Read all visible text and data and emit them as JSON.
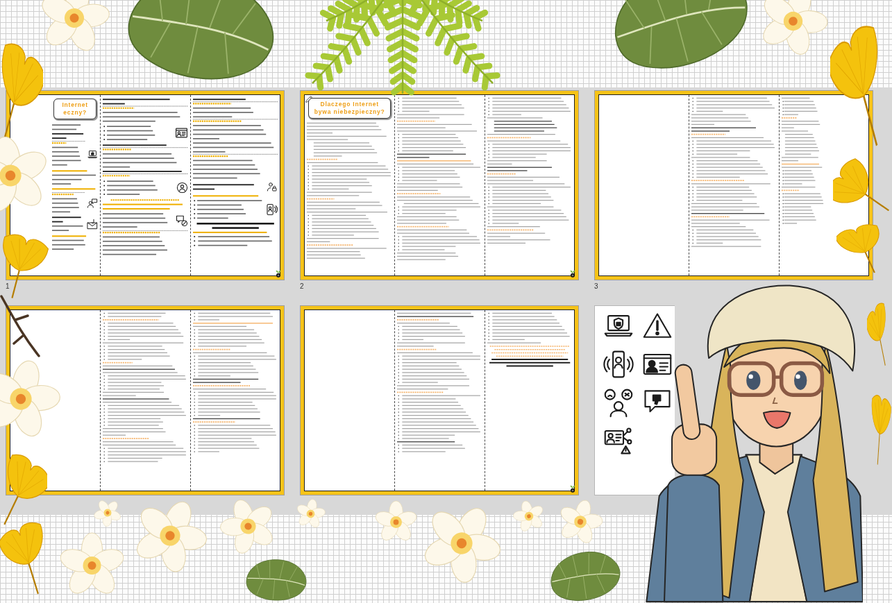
{
  "slides": [
    {
      "kind": "poster",
      "number": "1",
      "badge": true,
      "title": [
        "Internet",
        "eczny?"
      ]
    },
    {
      "kind": "handout",
      "number": "2",
      "badge": true,
      "title": [
        "Dlaczego Internet",
        "bywa niebezpieczny?"
      ]
    },
    {
      "kind": "handout",
      "number": "3",
      "badge": false
    },
    {
      "kind": "handout",
      "badge": false
    },
    {
      "kind": "handout",
      "badge": true
    },
    {
      "kind": "icons"
    }
  ]
}
